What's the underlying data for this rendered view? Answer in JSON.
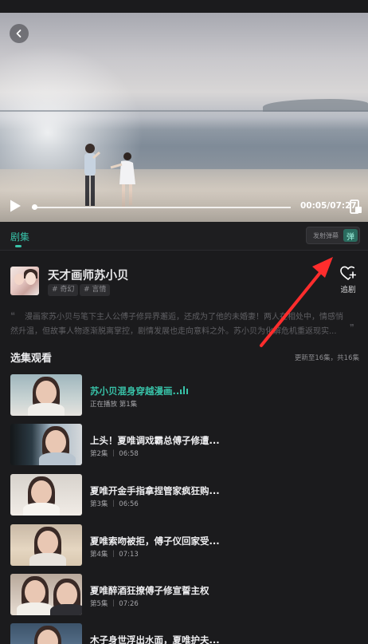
{
  "player": {
    "time": "00:05/07:27",
    "progress_fraction": 0.01
  },
  "tabs": {
    "episodes_label": "剧集",
    "danmu_placeholder": "发射弹幕",
    "danmu_toggle": "弹"
  },
  "show": {
    "title": "天才画师苏小贝",
    "tags": [
      "# 奇幻",
      "# 言情"
    ],
    "follow_label": "追剧",
    "synopsis": "漫画家苏小贝与笔下主人公傅子修异界邂逅，还成为了他的未婚妻！两人在相处中，情感悄然升温，但故事人物逐渐脱离掌控，剧情发展也走向意料之外。苏小贝为化解危机重返现实..."
  },
  "episodes_section": {
    "title": "选集观看",
    "update_info": "更新至16集，共16集"
  },
  "episodes": [
    {
      "title": "苏小贝混身穿越漫画...",
      "meta": "正在播放 第1集",
      "active": true
    },
    {
      "title": "上头！夏唯调戏霸总傅子修遭...",
      "meta": "第2集 ｜ 06:58",
      "active": false
    },
    {
      "title": "夏唯开金手指拿捏管家疯狂购...",
      "meta": "第3集 ｜ 06:56",
      "active": false
    },
    {
      "title": "夏唯索吻被拒，傅子仪回家受...",
      "meta": "第4集 ｜ 07:13",
      "active": false
    },
    {
      "title": "夏唯醉酒狂撩傅子修宣誓主权",
      "meta": "第5集 ｜ 07:26",
      "active": false
    },
    {
      "title": "木子身世浮出水面，夏唯护夫...",
      "meta": "",
      "active": false
    }
  ],
  "colors": {
    "accent": "#38c2a8",
    "annotation_arrow": "#ff2d2d"
  }
}
